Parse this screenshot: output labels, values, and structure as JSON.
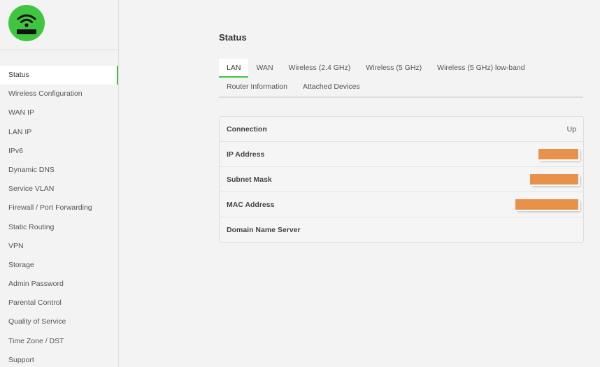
{
  "sidebar": {
    "items": [
      {
        "label": "Status",
        "active": true
      },
      {
        "label": "Wireless Configuration"
      },
      {
        "label": "WAN IP"
      },
      {
        "label": "LAN IP"
      },
      {
        "label": "IPv6"
      },
      {
        "label": "Dynamic DNS"
      },
      {
        "label": "Service VLAN"
      },
      {
        "label": "Firewall / Port Forwarding"
      },
      {
        "label": "Static Routing"
      },
      {
        "label": "VPN"
      },
      {
        "label": "Storage"
      },
      {
        "label": "Admin Password"
      },
      {
        "label": "Parental Control"
      },
      {
        "label": "Quality of Service"
      },
      {
        "label": "Time Zone / DST"
      },
      {
        "label": "Support"
      }
    ]
  },
  "main": {
    "title": "Status",
    "tabs_row1": [
      "LAN",
      "WAN",
      "Wireless (2.4 GHz)",
      "Wireless (5 GHz)",
      "Wireless (5 GHz) low-band"
    ],
    "tabs_row2": [
      "Router Information",
      "Attached Devices"
    ],
    "rows": [
      {
        "label": "Connection",
        "value": "Up"
      },
      {
        "label": "IP Address",
        "value": ""
      },
      {
        "label": "Subnet Mask",
        "value": ""
      },
      {
        "label": "MAC Address",
        "value": ""
      },
      {
        "label": "Domain Name Server",
        "value": ""
      }
    ]
  },
  "colors": {
    "accent": "#3fc53f",
    "redaction": "#e8914a"
  },
  "icons": {
    "logo": "router-wifi-icon"
  }
}
